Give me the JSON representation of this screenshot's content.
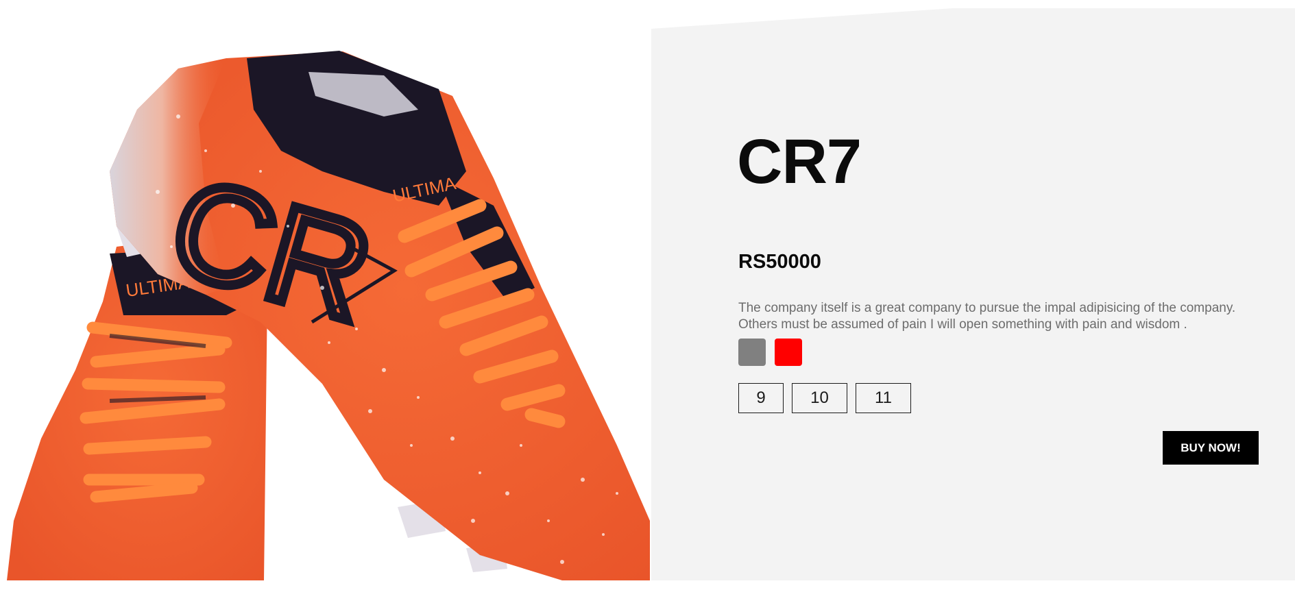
{
  "product": {
    "image_alt": "CR7 orange football boots",
    "image_logo_text": "CR",
    "image_brand_text": "ULTIMA",
    "title": "CR7",
    "price": "RS50000",
    "description": "The company itself is a great company to pursue the impal adipisicing of the company. Others must be assumed of pain I will open something with pain and wisdom .",
    "colors": [
      {
        "name": "grey",
        "hex": "#808080"
      },
      {
        "name": "red",
        "hex": "#ff0000"
      }
    ],
    "sizes": [
      "9",
      "10",
      "11"
    ],
    "buy_label": "BUY NOW!"
  },
  "colors": {
    "panel_background": "#f3f3f3",
    "boot_orange": "#f2622f",
    "lace_orange": "#ff8a3d",
    "collar_dark": "#1b1626"
  }
}
